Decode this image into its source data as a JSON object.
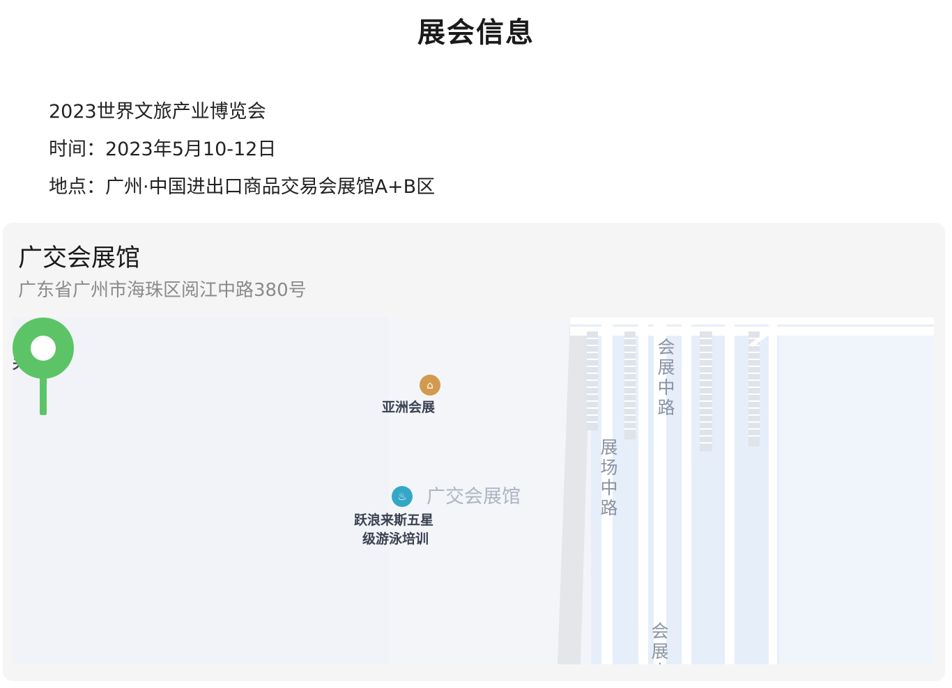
{
  "page": {
    "title": "展会信息"
  },
  "exhibition": {
    "name": "2023世界文旅产业博览会",
    "time": "时间：2023年5月10-12日",
    "location": "地点：广州·中国进出口商品交易会展馆A+B区"
  },
  "venue": {
    "name": "广交会展馆",
    "address": "广东省广州市海珠区阅江中路380号"
  },
  "map": {
    "edge_label": "夫",
    "poi_yazhou": "亚洲会展",
    "marker_label": "广交会展馆",
    "poi_swim_line1": "跃浪来斯五星",
    "poi_swim_line2": "级游泳培训",
    "road_huizhan_top": "会展中路",
    "road_zhanchang": "展场中路",
    "road_huizhan_bottom": "会展中",
    "pin_color": "#5cc466",
    "road_color": "#e3ecf8"
  }
}
